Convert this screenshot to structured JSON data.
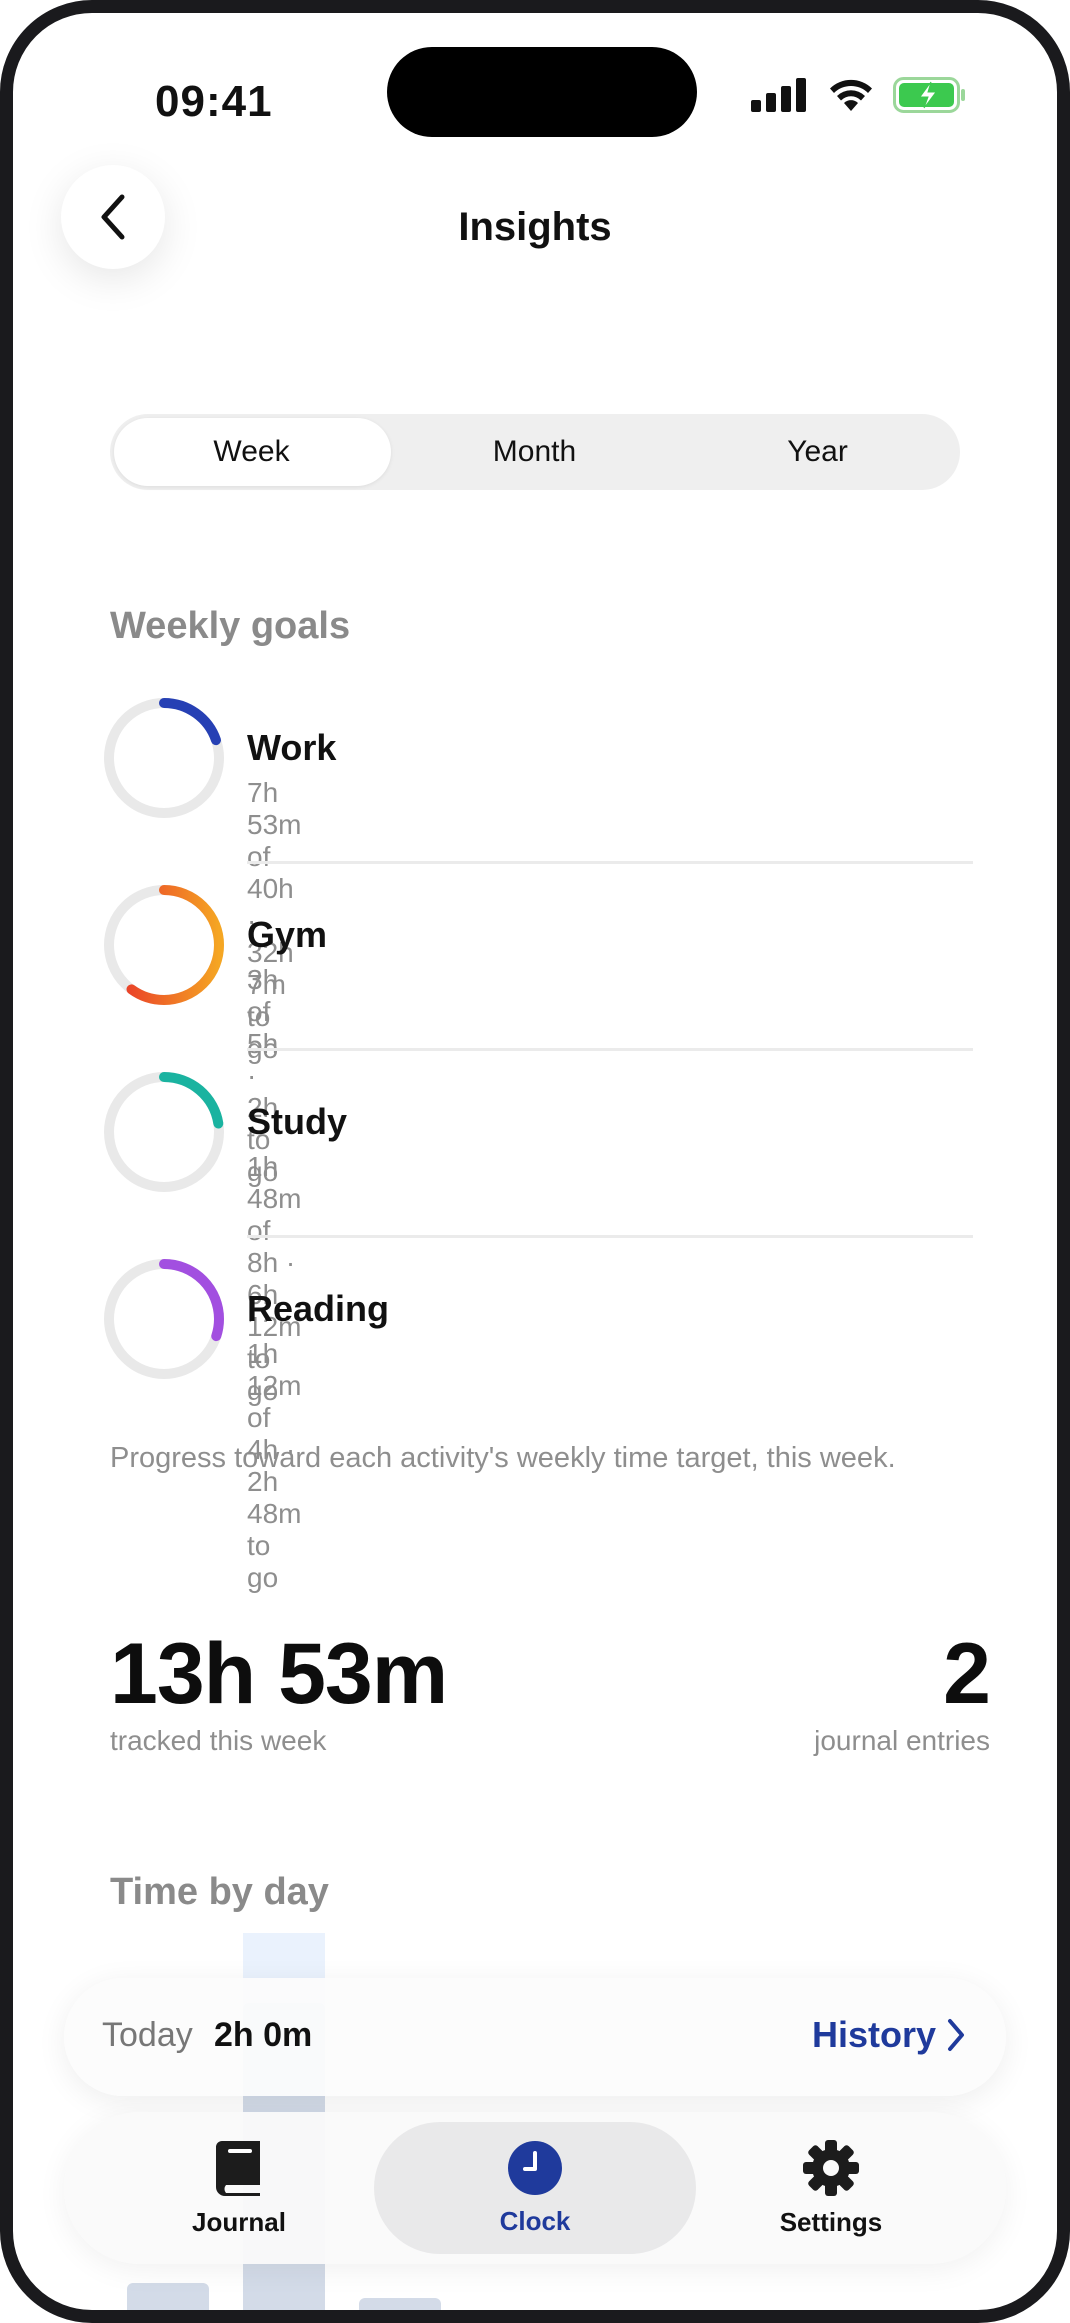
{
  "status_bar": {
    "time": "09:41"
  },
  "header": {
    "title": "Insights"
  },
  "segments": {
    "items": [
      "Week",
      "Month",
      "Year"
    ],
    "selected": "Week"
  },
  "weekly_goals": {
    "title": "Weekly goals",
    "items": [
      {
        "name": "Work",
        "detail": "7h 53m of 40h · 32h 7m to go",
        "progress": 0.197,
        "color": "#2640b4"
      },
      {
        "name": "Gym",
        "detail": "3h of 5h · 2h to go",
        "progress": 0.6,
        "color": "#ee5a24"
      },
      {
        "name": "Study",
        "detail": "1h 48m of 8h · 6h 12m to go",
        "progress": 0.225,
        "color": "#1ab3a0"
      },
      {
        "name": "Reading",
        "detail": "1h 12m of 4h · 2h 48m to go",
        "progress": 0.3,
        "color": "#a24fe0"
      }
    ],
    "caption": "Progress toward each activity's weekly time target, this week."
  },
  "summary": {
    "tracked_value": "13h 53m",
    "tracked_label": "tracked this week",
    "entries_value": "2",
    "entries_label": "journal entries"
  },
  "time_by_day": {
    "title": "Time by day"
  },
  "today": {
    "label": "Today",
    "value": "2h 0m",
    "history_label": "History"
  },
  "tabbar": {
    "items": [
      {
        "label": "Journal",
        "icon": "book-icon"
      },
      {
        "label": "Clock",
        "icon": "clock-icon"
      },
      {
        "label": "Settings",
        "icon": "gear-icon"
      }
    ],
    "active": "Clock",
    "accent": "#1f3a9c"
  }
}
